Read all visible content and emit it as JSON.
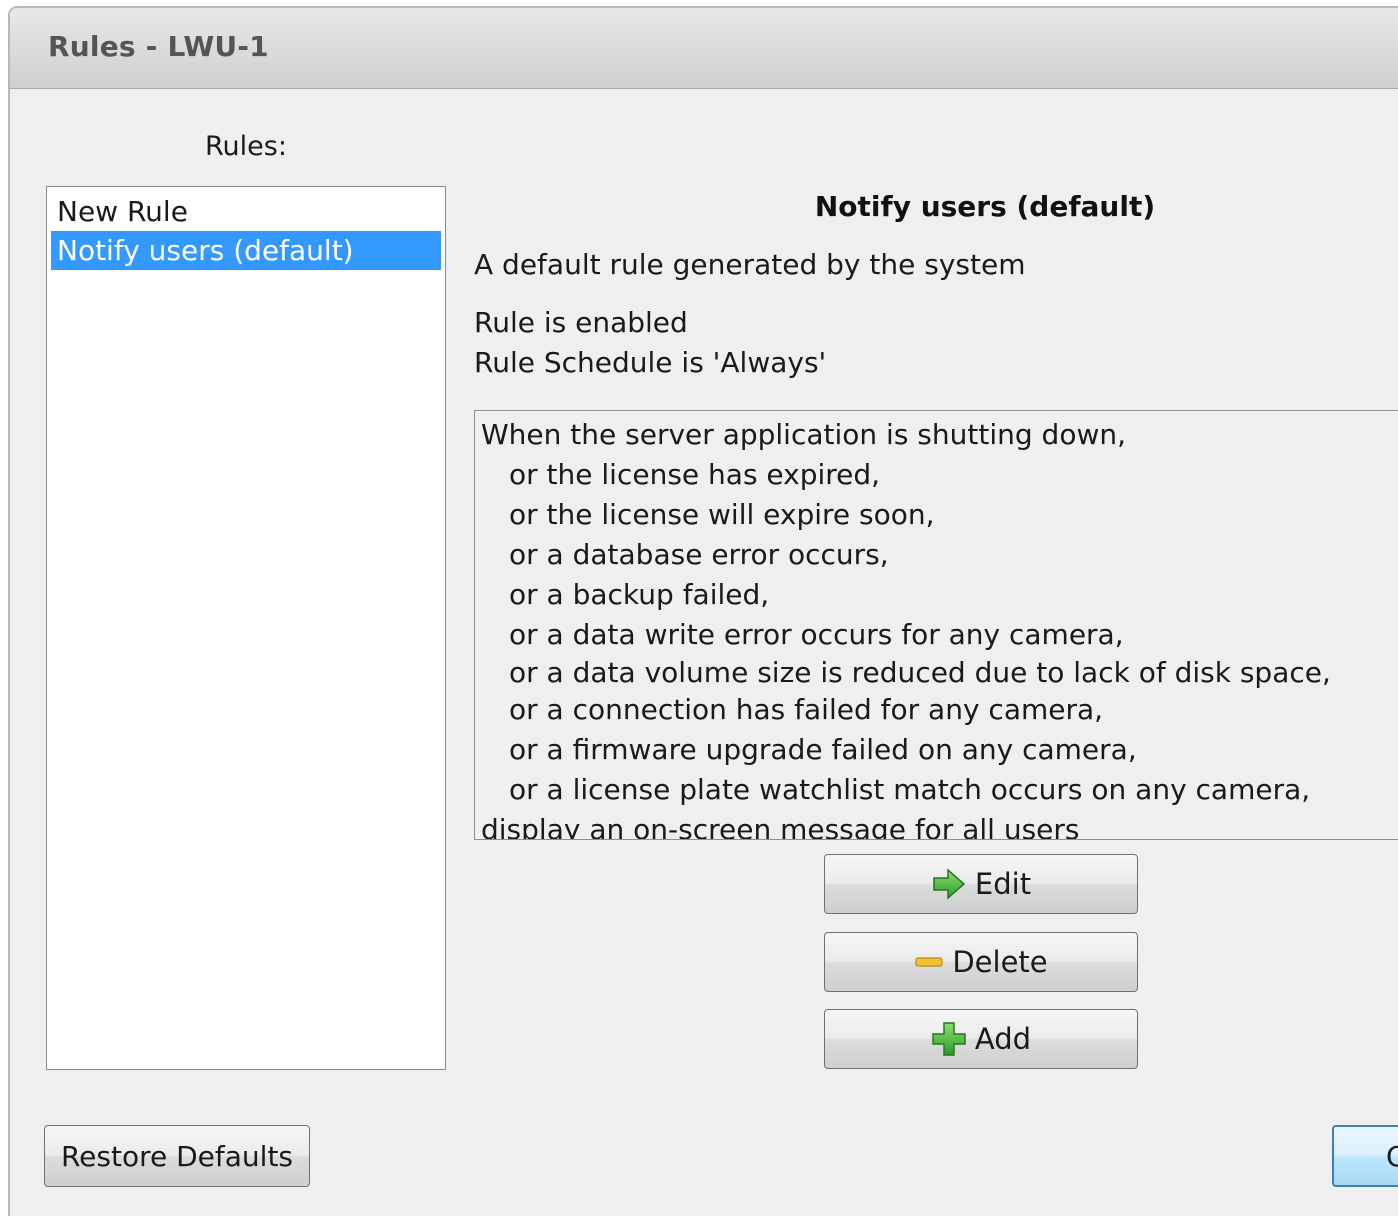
{
  "window": {
    "title": "Rules - LWU-1"
  },
  "rules_panel": {
    "label": "Rules:",
    "items": [
      {
        "label": "New Rule",
        "selected": false
      },
      {
        "label": "Notify users (default)",
        "selected": true
      }
    ]
  },
  "details": {
    "name": "Notify users (default)",
    "description": "A default rule generated by the system",
    "status_enabled": "Rule is enabled",
    "status_schedule": "Rule Schedule is 'Always'",
    "summary": {
      "line0": "When the server application is shutting down,",
      "line1": "or the license has expired,",
      "line2": "or the license will expire soon,",
      "line3": "or a database error occurs,",
      "line4": "or a backup failed,",
      "line5": "or a data write error occurs for any camera,",
      "line6": "or a data volume size is reduced due to lack of disk space,",
      "line7": "or a connection has failed for any camera,",
      "line8": "or a firmware upgrade failed on any camera,",
      "line9": "or a license plate watchlist match occurs on any camera,",
      "line10": "display an on-screen message for all users"
    }
  },
  "buttons": {
    "edit": {
      "label": "Edit",
      "icon": "arrow-right-icon"
    },
    "delete": {
      "label": "Delete",
      "icon": "minus-icon"
    },
    "add": {
      "label": "Add",
      "icon": "plus-icon"
    },
    "restore_defaults": "Restore Defaults",
    "ok": "O"
  },
  "colors": {
    "selection": "#3399ff",
    "icon_green": "#3cb043",
    "icon_yellow": "#f2c230"
  }
}
